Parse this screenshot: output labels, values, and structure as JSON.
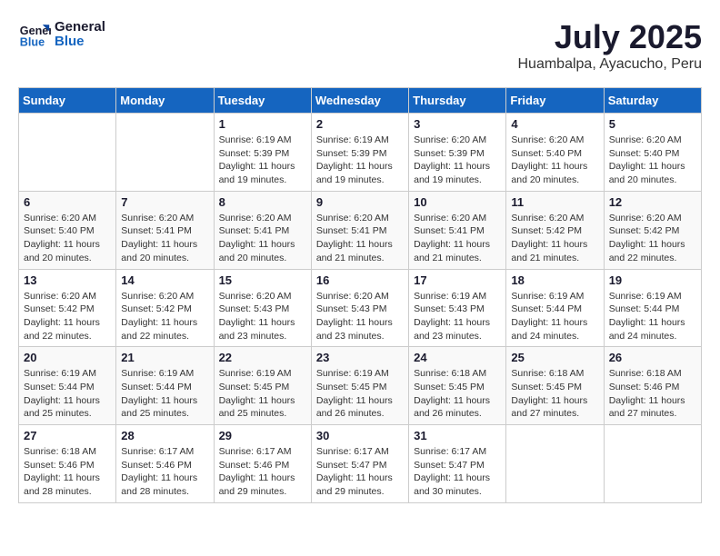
{
  "header": {
    "logo_line1": "General",
    "logo_line2": "Blue",
    "month": "July 2025",
    "location": "Huambalpa, Ayacucho, Peru"
  },
  "days_of_week": [
    "Sunday",
    "Monday",
    "Tuesday",
    "Wednesday",
    "Thursday",
    "Friday",
    "Saturday"
  ],
  "weeks": [
    [
      {
        "day": "",
        "info": ""
      },
      {
        "day": "",
        "info": ""
      },
      {
        "day": "1",
        "info": "Sunrise: 6:19 AM\nSunset: 5:39 PM\nDaylight: 11 hours and 19 minutes."
      },
      {
        "day": "2",
        "info": "Sunrise: 6:19 AM\nSunset: 5:39 PM\nDaylight: 11 hours and 19 minutes."
      },
      {
        "day": "3",
        "info": "Sunrise: 6:20 AM\nSunset: 5:39 PM\nDaylight: 11 hours and 19 minutes."
      },
      {
        "day": "4",
        "info": "Sunrise: 6:20 AM\nSunset: 5:40 PM\nDaylight: 11 hours and 20 minutes."
      },
      {
        "day": "5",
        "info": "Sunrise: 6:20 AM\nSunset: 5:40 PM\nDaylight: 11 hours and 20 minutes."
      }
    ],
    [
      {
        "day": "6",
        "info": "Sunrise: 6:20 AM\nSunset: 5:40 PM\nDaylight: 11 hours and 20 minutes."
      },
      {
        "day": "7",
        "info": "Sunrise: 6:20 AM\nSunset: 5:41 PM\nDaylight: 11 hours and 20 minutes."
      },
      {
        "day": "8",
        "info": "Sunrise: 6:20 AM\nSunset: 5:41 PM\nDaylight: 11 hours and 20 minutes."
      },
      {
        "day": "9",
        "info": "Sunrise: 6:20 AM\nSunset: 5:41 PM\nDaylight: 11 hours and 21 minutes."
      },
      {
        "day": "10",
        "info": "Sunrise: 6:20 AM\nSunset: 5:41 PM\nDaylight: 11 hours and 21 minutes."
      },
      {
        "day": "11",
        "info": "Sunrise: 6:20 AM\nSunset: 5:42 PM\nDaylight: 11 hours and 21 minutes."
      },
      {
        "day": "12",
        "info": "Sunrise: 6:20 AM\nSunset: 5:42 PM\nDaylight: 11 hours and 22 minutes."
      }
    ],
    [
      {
        "day": "13",
        "info": "Sunrise: 6:20 AM\nSunset: 5:42 PM\nDaylight: 11 hours and 22 minutes."
      },
      {
        "day": "14",
        "info": "Sunrise: 6:20 AM\nSunset: 5:42 PM\nDaylight: 11 hours and 22 minutes."
      },
      {
        "day": "15",
        "info": "Sunrise: 6:20 AM\nSunset: 5:43 PM\nDaylight: 11 hours and 23 minutes."
      },
      {
        "day": "16",
        "info": "Sunrise: 6:20 AM\nSunset: 5:43 PM\nDaylight: 11 hours and 23 minutes."
      },
      {
        "day": "17",
        "info": "Sunrise: 6:19 AM\nSunset: 5:43 PM\nDaylight: 11 hours and 23 minutes."
      },
      {
        "day": "18",
        "info": "Sunrise: 6:19 AM\nSunset: 5:44 PM\nDaylight: 11 hours and 24 minutes."
      },
      {
        "day": "19",
        "info": "Sunrise: 6:19 AM\nSunset: 5:44 PM\nDaylight: 11 hours and 24 minutes."
      }
    ],
    [
      {
        "day": "20",
        "info": "Sunrise: 6:19 AM\nSunset: 5:44 PM\nDaylight: 11 hours and 25 minutes."
      },
      {
        "day": "21",
        "info": "Sunrise: 6:19 AM\nSunset: 5:44 PM\nDaylight: 11 hours and 25 minutes."
      },
      {
        "day": "22",
        "info": "Sunrise: 6:19 AM\nSunset: 5:45 PM\nDaylight: 11 hours and 25 minutes."
      },
      {
        "day": "23",
        "info": "Sunrise: 6:19 AM\nSunset: 5:45 PM\nDaylight: 11 hours and 26 minutes."
      },
      {
        "day": "24",
        "info": "Sunrise: 6:18 AM\nSunset: 5:45 PM\nDaylight: 11 hours and 26 minutes."
      },
      {
        "day": "25",
        "info": "Sunrise: 6:18 AM\nSunset: 5:45 PM\nDaylight: 11 hours and 27 minutes."
      },
      {
        "day": "26",
        "info": "Sunrise: 6:18 AM\nSunset: 5:46 PM\nDaylight: 11 hours and 27 minutes."
      }
    ],
    [
      {
        "day": "27",
        "info": "Sunrise: 6:18 AM\nSunset: 5:46 PM\nDaylight: 11 hours and 28 minutes."
      },
      {
        "day": "28",
        "info": "Sunrise: 6:17 AM\nSunset: 5:46 PM\nDaylight: 11 hours and 28 minutes."
      },
      {
        "day": "29",
        "info": "Sunrise: 6:17 AM\nSunset: 5:46 PM\nDaylight: 11 hours and 29 minutes."
      },
      {
        "day": "30",
        "info": "Sunrise: 6:17 AM\nSunset: 5:47 PM\nDaylight: 11 hours and 29 minutes."
      },
      {
        "day": "31",
        "info": "Sunrise: 6:17 AM\nSunset: 5:47 PM\nDaylight: 11 hours and 30 minutes."
      },
      {
        "day": "",
        "info": ""
      },
      {
        "day": "",
        "info": ""
      }
    ]
  ]
}
